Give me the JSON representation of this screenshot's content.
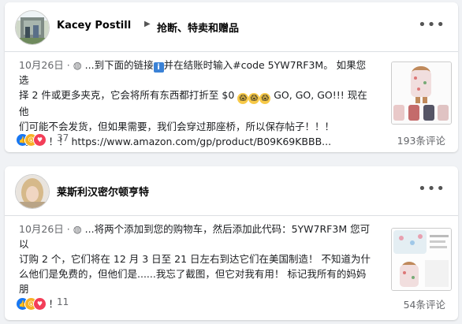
{
  "posts": [
    {
      "author": "Kacey Postill",
      "group": "抢断、特卖和赠品",
      "date": "10月26日",
      "text_line1_a": "...到下面的链接",
      "info_glyph": "i",
      "text_line1_b": "并在结账时输入#code 5YW7RF3M。 如果您选",
      "text_line2_a": "择 2 件或更多夹克，它会将所有东西都打折至 $0",
      "text_line2_b": "GO, GO, GO!!! 现在他",
      "text_line3": "们可能不会发货，但如果需要，我们会穿过那座桥，所以保存帖子！！！",
      "text_line4": "走！！！！ https://www.amazon.com/gp/product/B09K69KBBB...",
      "reaction_count": "37",
      "comment_count": "193条评论"
    },
    {
      "author": "莱斯利汉密尔顿亨特",
      "date": "10月26日",
      "text_line1": "...将两个添加到您的购物车，然后添加此代码：5YW7RF3M 您可以",
      "text_line2": "订购 2 个，它们将在 12 月 3 日至 21 日左右到达它们在美国制造！ 不知道为什",
      "text_line3": "么他们是免费的，但他们是......我忘了截图，但它对我有用！ 标记我所有的妈妈朋",
      "text_line4": "友！！！",
      "reaction_count": "11",
      "comment_count": "54条评论"
    }
  ],
  "more_glyph": "•••",
  "arrow_glyph": "▶",
  "separator": "·",
  "colors": {
    "like": "#1877f2",
    "love": "#f33e58",
    "haha": "#f7b125"
  }
}
